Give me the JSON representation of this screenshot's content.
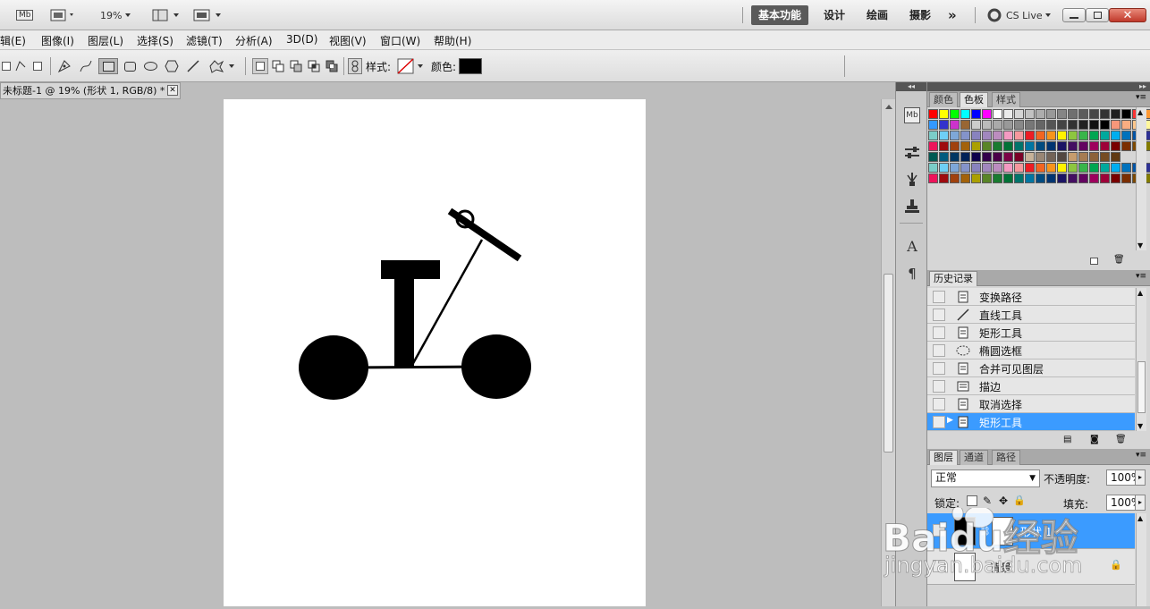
{
  "appbar": {
    "mb_label": "Mb",
    "zoom": "19%",
    "workspaces": [
      "基本功能",
      "设计",
      "绘画",
      "摄影"
    ],
    "more": "»",
    "cslive": "CS Live"
  },
  "menu": [
    "辑(E)",
    "图像(I)",
    "图层(L)",
    "选择(S)",
    "滤镜(T)",
    "分析(A)",
    "3D(D)",
    "视图(V)",
    "窗口(W)",
    "帮助(H)"
  ],
  "options": {
    "style_label": "样式:",
    "color_label": "颜色:",
    "color_value": "#000000"
  },
  "document": {
    "tab_title": "未标题-1 @ 19% (形状 1, RGB/8) *"
  },
  "swatches_panel": {
    "tabs": [
      "颜色",
      "色板",
      "样式"
    ],
    "active_tab": "色板"
  },
  "history_panel": {
    "title": "历史记录",
    "items": [
      "变换路径",
      "直线工具",
      "矩形工具",
      "椭圆选框",
      "合并可见图层",
      "描边",
      "取消选择",
      "矩形工具"
    ],
    "icons": [
      "doc-icon",
      "line-tool-icon",
      "doc-icon",
      "ellipse-marquee-icon",
      "doc-icon",
      "stroke-icon",
      "doc-icon",
      "doc-icon"
    ],
    "selected_index": 7
  },
  "layers_panel": {
    "tabs": [
      "图层",
      "通道",
      "路径"
    ],
    "blend_mode": "正常",
    "opacity_label": "不透明度:",
    "opacity_value": "100%",
    "lock_label": "锁定:",
    "fill_label": "填充:",
    "fill_value": "100%",
    "layers": [
      "形状 1",
      "背景"
    ]
  },
  "watermark": {
    "logo": "Baidu经验",
    "url": "jingyan.baidu.com"
  }
}
